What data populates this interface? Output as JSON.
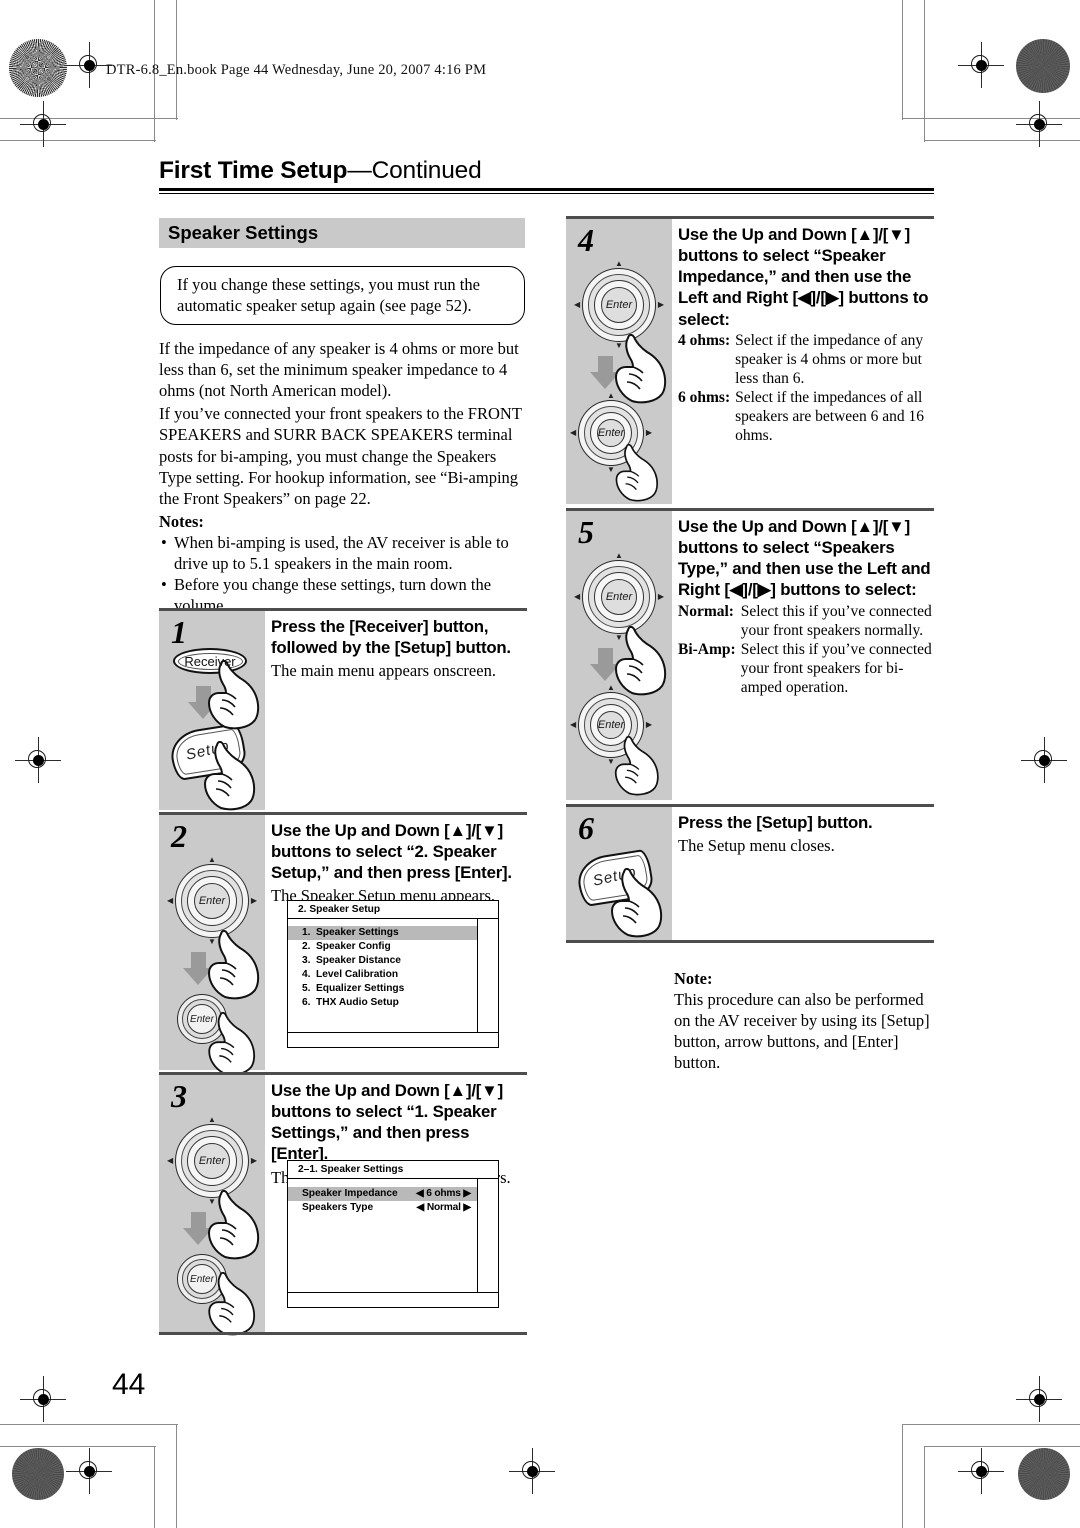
{
  "header": {
    "slug": "DTR-6.8_En.book   Page 44   Wednesday, June 20, 2007   4:16 PM"
  },
  "chapter": {
    "title": "First Time Setup",
    "continued": "—Continued"
  },
  "section": {
    "heading": "Speaker Settings"
  },
  "callout": {
    "text": "If you change these settings, you must run the automatic speaker setup again (see page 52)."
  },
  "intro": {
    "para1": "If the impedance of any speaker is 4 ohms or more but less than 6, set the minimum speaker impedance to 4 ohms (not North American model).",
    "para2": "If you’ve connected your front speakers to the FRONT SPEAKERS and SURR BACK SPEAKERS terminal posts for bi-amping, you must change the Speakers Type setting. For hookup information, see “Bi-amping the Front Speakers” on page 22.",
    "notes_label": "Notes:",
    "bullets": [
      "When bi-amping is used, the AV receiver is able to drive up to 5.1 speakers in the main room.",
      "Before you change these settings, turn down the volume."
    ]
  },
  "steps": [
    {
      "number": "1",
      "heading": "Press the [Receiver] button, followed by the [Setup] button.",
      "sub": "The main menu appears onscreen.",
      "button_receiver": "Receiver",
      "button_setup": "Setup"
    },
    {
      "number": "2",
      "heading": "Use the Up and Down [▲]/[▼] buttons to select “2. Speaker Setup,” and then press [Enter].",
      "sub": "The Speaker Setup menu appears.",
      "wheel_label": "Enter",
      "wheel_small_label": "Enter"
    },
    {
      "number": "3",
      "heading": "Use the Up and Down [▲]/[▼] buttons to select “1. Speaker Settings,” and then press [Enter].",
      "sub": "The Speaker Settings menu appears.",
      "wheel_label": "Enter",
      "wheel_small_label": "Enter"
    },
    {
      "number": "4",
      "heading": "Use the Up and Down [▲]/[▼] buttons to select “Speaker Impedance,” and then use the Left and Right [◀]/[▶] buttons to select:",
      "definitions": [
        {
          "term": "4 ohms:",
          "desc": "Select if the impedance of any speaker is 4 ohms or more but less than 6."
        },
        {
          "term": "6 ohms:",
          "desc": "Select if the impedances of all speakers are between 6 and 16 ohms."
        }
      ],
      "wheel_label": "Enter",
      "wheel_small_label": "Enter"
    },
    {
      "number": "5",
      "heading": "Use the Up and Down [▲]/[▼] buttons to select “Speakers Type,” and then use the Left and Right [◀]/[▶] buttons to select:",
      "definitions": [
        {
          "term": "Normal:",
          "desc": "Select this if you’ve connected your front speakers normally."
        },
        {
          "term": "Bi-Amp:",
          "desc": "Select this if you’ve connected your front speakers for bi-amped operation."
        }
      ],
      "wheel_label": "Enter",
      "wheel_small_label": "Enter"
    },
    {
      "number": "6",
      "heading": "Press the [Setup] button.",
      "sub": "The Setup menu closes.",
      "button_setup": "Setup"
    }
  ],
  "osd_speaker_setup": {
    "title": "2.  Speaker Setup",
    "rows": [
      {
        "idx": "1.",
        "label": "Speaker Settings",
        "selected": true
      },
      {
        "idx": "2.",
        "label": "Speaker Config",
        "selected": false
      },
      {
        "idx": "3.",
        "label": "Speaker Distance",
        "selected": false
      },
      {
        "idx": "4.",
        "label": "Level Calibration",
        "selected": false
      },
      {
        "idx": "5.",
        "label": "Equalizer Settings",
        "selected": false
      },
      {
        "idx": "6.",
        "label": "THX Audio Setup",
        "selected": false
      }
    ]
  },
  "osd_speaker_settings": {
    "title": "2–1.  Speaker Settings",
    "rows": [
      {
        "label": "Speaker Impedance",
        "value": "6 ohms",
        "selected": true
      },
      {
        "label": "Speakers Type",
        "value": "Normal",
        "selected": false
      }
    ],
    "left_arrow": "◀",
    "right_arrow": "▶"
  },
  "final_note": {
    "label": "Note:",
    "text": "This procedure can also be performed on the AV receiver by using its [Setup] button, arrow buttons, and [Enter] button."
  },
  "footer": {
    "page_number": "44"
  }
}
